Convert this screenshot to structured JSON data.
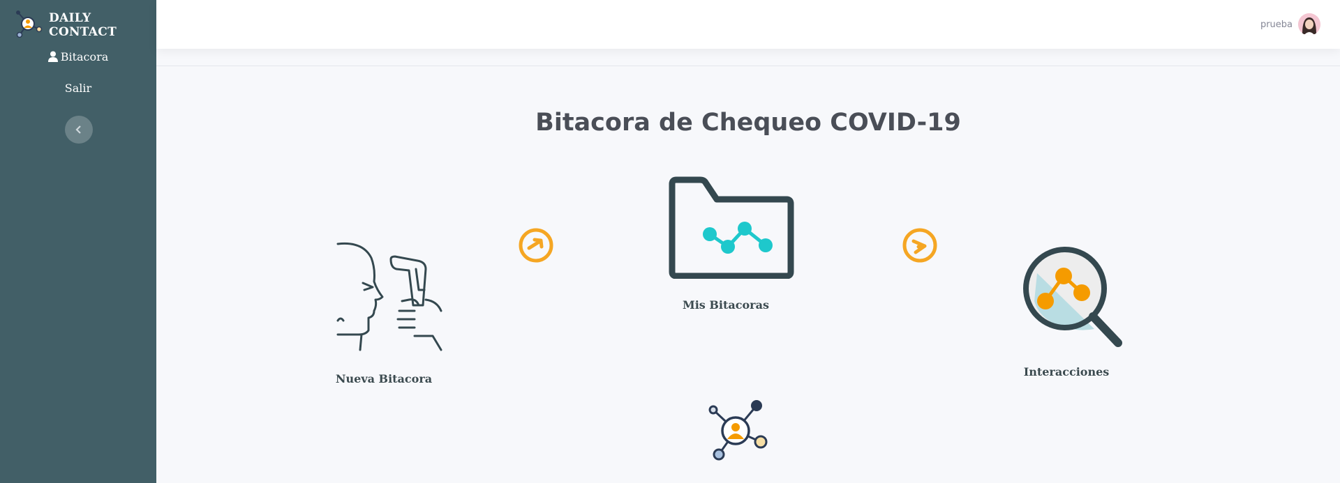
{
  "brand": {
    "name": "DAILY CONTACT"
  },
  "sidebar": {
    "items": [
      {
        "label": "Bitacora"
      },
      {
        "label": "Salir"
      }
    ]
  },
  "header": {
    "user_name": "prueba"
  },
  "main": {
    "title": "Bitacora de Chequeo COVID-19",
    "cards": [
      {
        "label": "Nueva Bitacora"
      },
      {
        "label": "Mis Bitacoras"
      },
      {
        "label": "Interacciones"
      }
    ]
  },
  "colors": {
    "sidebar": "#425f67",
    "accent_orange": "#f5a623",
    "teal": "#1ec8cc",
    "dark": "#34484f"
  }
}
